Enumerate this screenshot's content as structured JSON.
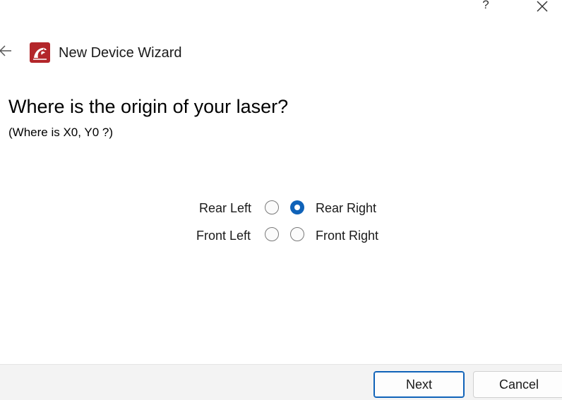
{
  "window": {
    "help_glyph": "?",
    "close_icon": "close-icon"
  },
  "header": {
    "back_icon": "back-arrow-icon",
    "app_icon": "app-logo-icon",
    "title": "New Device Wizard"
  },
  "page": {
    "question": "Where is the origin of your laser?",
    "subquestion": "(Where is X0, Y0 ?)"
  },
  "origin_options": {
    "rear_left": {
      "label": "Rear Left",
      "checked": false
    },
    "rear_right": {
      "label": "Rear Right",
      "checked": true
    },
    "front_left": {
      "label": "Front Left",
      "checked": false
    },
    "front_right": {
      "label": "Front Right",
      "checked": false
    }
  },
  "footer": {
    "next_label": "Next",
    "cancel_label": "Cancel"
  },
  "colors": {
    "accent": "#0f62b8",
    "footer_bg": "#f3f3f3",
    "logo_red": "#b3262a"
  }
}
